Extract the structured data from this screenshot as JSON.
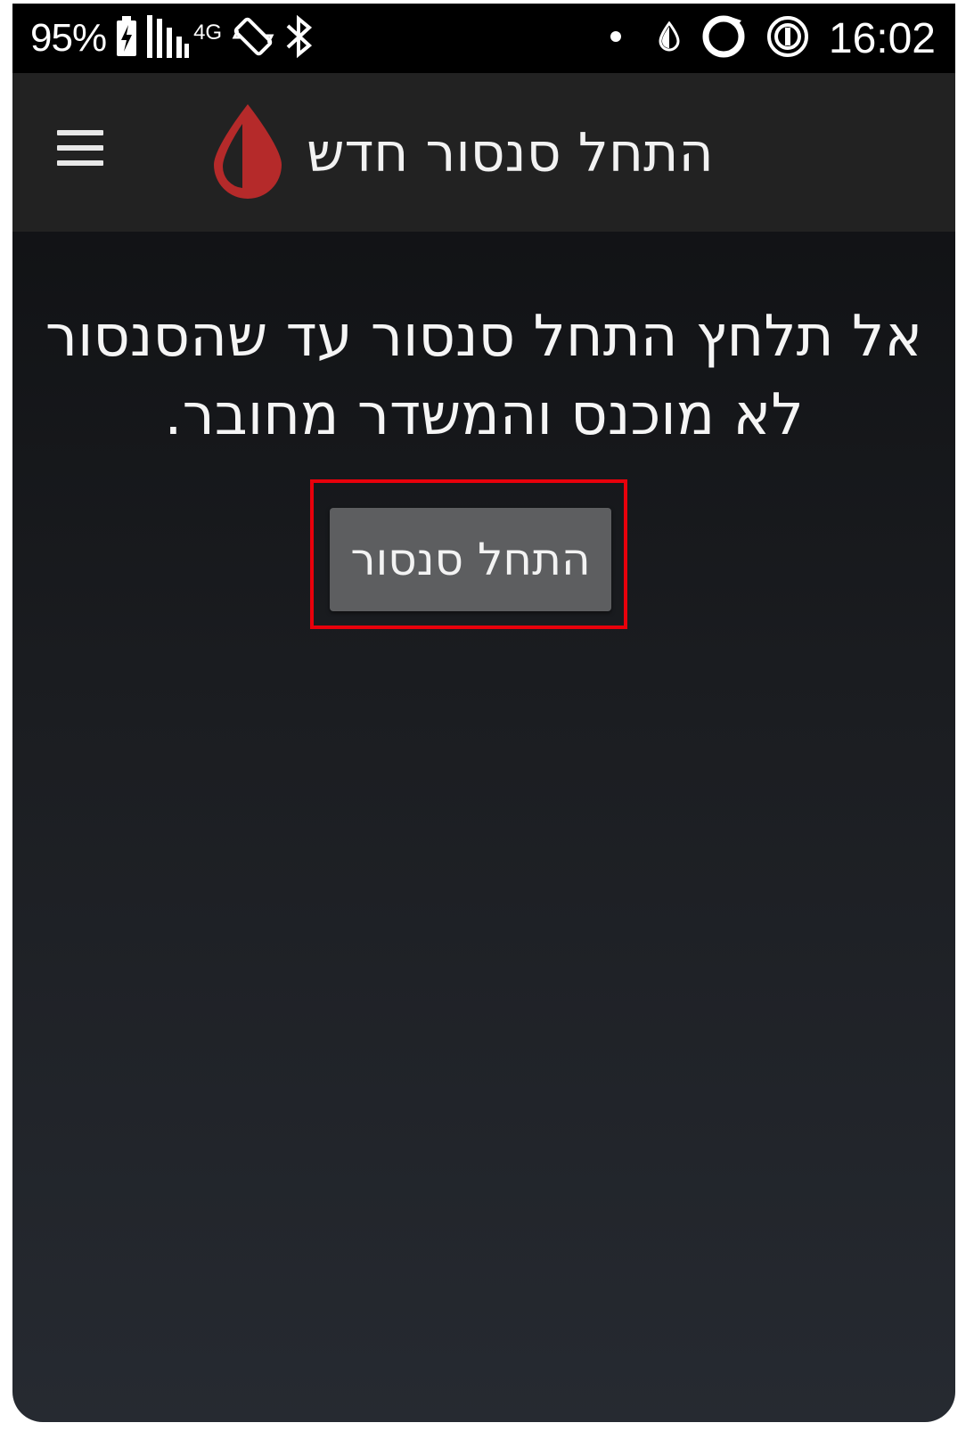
{
  "status_bar": {
    "battery_percent": "95%",
    "network_type": "4G",
    "time": "16:02",
    "icons": [
      "battery-charging-icon",
      "signal-icon",
      "auto-rotate-icon",
      "bluetooth-icon",
      "dot-icon",
      "drop-icon",
      "ring-icon",
      "data-saver-icon"
    ]
  },
  "app_bar": {
    "title": "התחל סנסור חדש",
    "logo_icon": "blood-drop-icon",
    "menu_icon": "hamburger-menu-icon"
  },
  "main": {
    "message": "אל תלחץ התחל סנסור עד שהסנסור לא מוכנס והמשדר מחובר.",
    "start_button_label": "התחל סנסור"
  },
  "colors": {
    "logo_red": "#b52a2a",
    "highlight_red": "#e8000b",
    "button_gray": "#5d5e60",
    "app_bar_bg": "#222222"
  }
}
